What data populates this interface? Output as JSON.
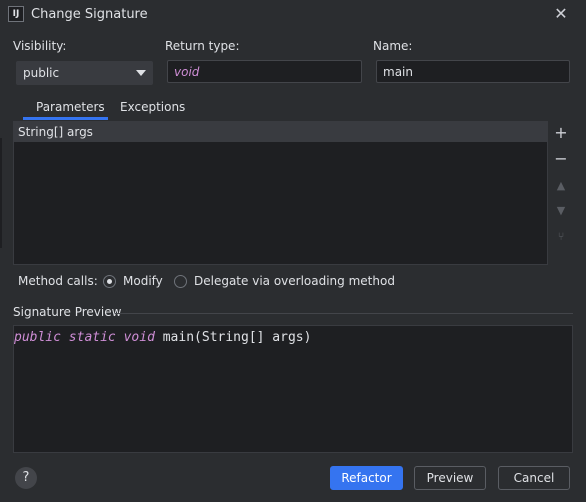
{
  "window": {
    "title": "Change Signature",
    "icon_text": "IJ"
  },
  "form": {
    "visibility_label": "Visibility:",
    "visibility_value": "public",
    "return_type_label": "Return type:",
    "return_type_value": "void",
    "name_label": "Name:",
    "name_value": "main"
  },
  "tabs": [
    {
      "label": "Parameters",
      "active": true
    },
    {
      "label": "Exceptions",
      "active": false
    }
  ],
  "parameters": [
    {
      "text": "String[] args"
    }
  ],
  "side_actions": [
    {
      "name": "add",
      "glyph": "+"
    },
    {
      "name": "remove",
      "glyph": "−"
    },
    {
      "name": "move-up",
      "glyph": "▲"
    },
    {
      "name": "move-down",
      "glyph": "▼"
    },
    {
      "name": "propagate",
      "glyph": "⑂"
    }
  ],
  "method_calls": {
    "label": "Method calls:",
    "modify_label": "Modify",
    "delegate_label": "Delegate via overloading method",
    "selected": "Modify"
  },
  "preview": {
    "title": "Signature Preview",
    "keywords": [
      "public",
      "static",
      "void"
    ],
    "rest": " main(String[] args)"
  },
  "buttons": {
    "help": "?",
    "refactor": "Refactor",
    "preview": "Preview",
    "cancel": "Cancel"
  },
  "colors": {
    "accent": "#3574f0",
    "keyword": "#cf8ed6",
    "background": "#2b2d30",
    "field": "#1e1f22"
  }
}
